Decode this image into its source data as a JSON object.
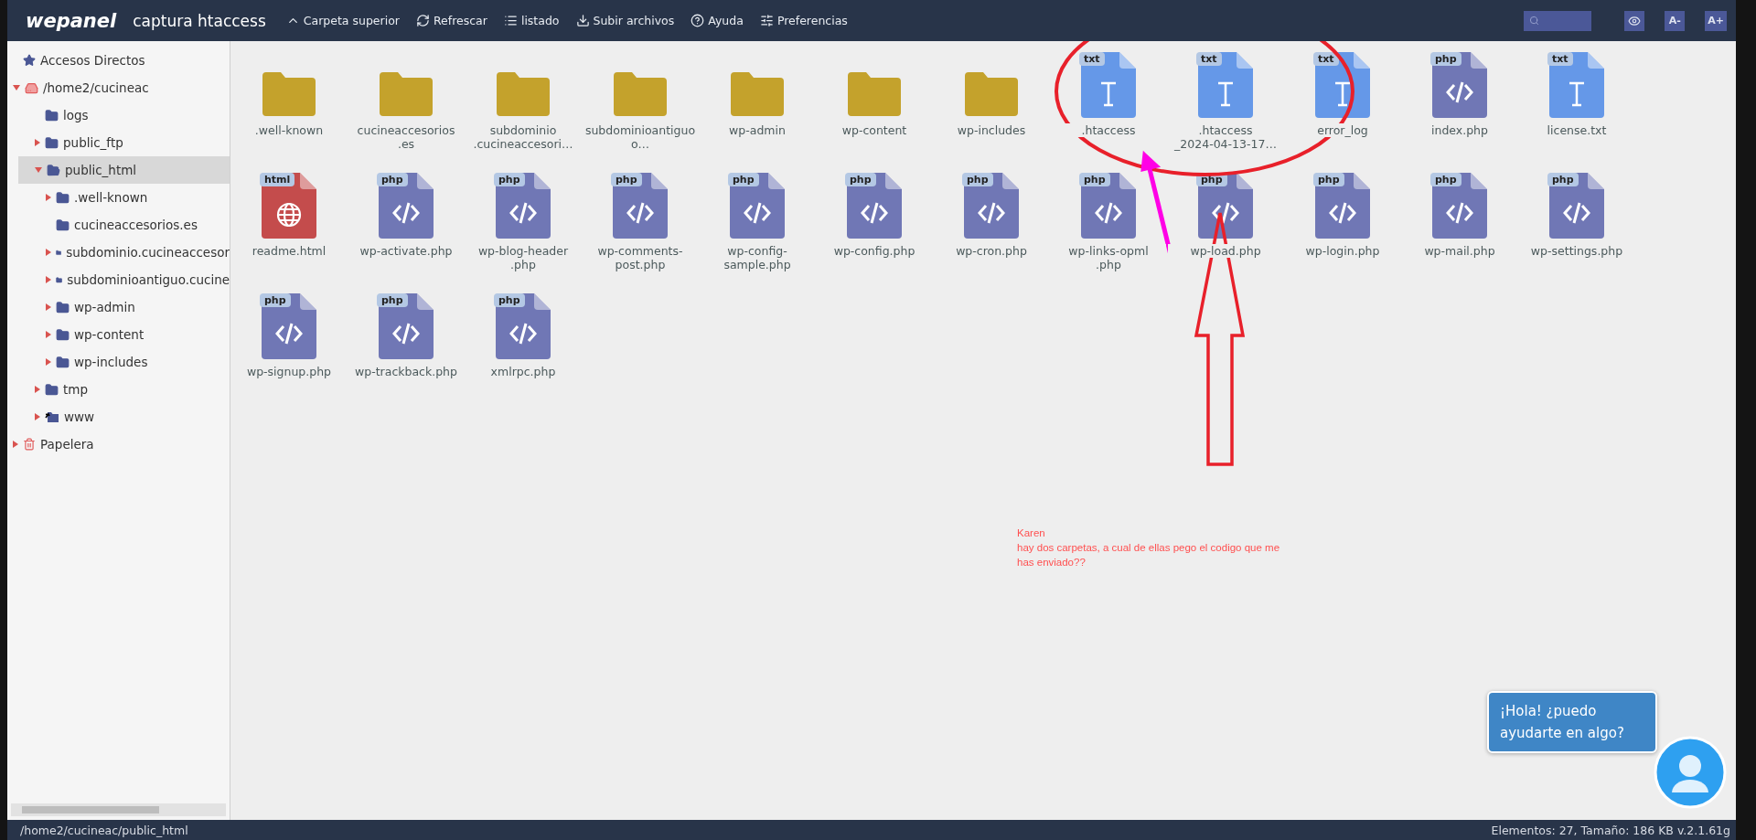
{
  "header": {
    "logo": "wepanel",
    "title": "captura htaccess",
    "toolbar": [
      {
        "kind": "up",
        "label": "Carpeta superior"
      },
      {
        "kind": "refresh",
        "label": "Refrescar"
      },
      {
        "kind": "list",
        "label": "listado"
      },
      {
        "kind": "upload",
        "label": "Subir archivos"
      },
      {
        "kind": "help",
        "label": "Ayuda"
      },
      {
        "kind": "prefs",
        "label": "Preferencias"
      }
    ],
    "font_buttons": [
      "A-",
      "A+"
    ]
  },
  "sidebar": {
    "tree": [
      {
        "label": "Accesos Directos",
        "kind": "shortcut",
        "selected": false
      },
      {
        "label": "/home2/cucineac",
        "kind": "drive",
        "expanded": true,
        "selected": false,
        "children": [
          {
            "label": "logs",
            "kind": "folder",
            "selected": false
          },
          {
            "label": "public_ftp",
            "kind": "folder",
            "expanded": false,
            "selected": false
          },
          {
            "label": "public_html",
            "kind": "folder-open",
            "expanded": true,
            "selected": true,
            "children": [
              {
                "label": ".well-known",
                "kind": "folder",
                "expanded": false,
                "selected": false
              },
              {
                "label": "cucineaccesorios.es",
                "kind": "folder",
                "selected": false
              },
              {
                "label": "subdominio.cucineaccesor",
                "kind": "folder",
                "expanded": false,
                "selected": false
              },
              {
                "label": "subdominioantiguo.cucine",
                "kind": "folder",
                "expanded": false,
                "selected": false
              },
              {
                "label": "wp-admin",
                "kind": "folder",
                "expanded": false,
                "selected": false
              },
              {
                "label": "wp-content",
                "kind": "folder",
                "expanded": false,
                "selected": false
              },
              {
                "label": "wp-includes",
                "kind": "folder",
                "expanded": false,
                "selected": false
              }
            ]
          },
          {
            "label": "tmp",
            "kind": "folder",
            "expanded": false,
            "selected": false
          },
          {
            "label": "www",
            "kind": "link-folder",
            "expanded": false,
            "selected": false
          }
        ]
      },
      {
        "label": "Papelera",
        "kind": "trash",
        "expanded": false,
        "selected": false
      }
    ]
  },
  "files": [
    {
      "kind": "folder",
      "lines": [
        ".well-known"
      ]
    },
    {
      "kind": "folder",
      "lines": [
        "cucineaccesorios",
        ".es"
      ]
    },
    {
      "kind": "folder",
      "lines": [
        "subdominio",
        ".cucineaccesori…"
      ]
    },
    {
      "kind": "folder",
      "lines": [
        "subdominioantiguo",
        "o…"
      ]
    },
    {
      "kind": "folder",
      "lines": [
        "wp-admin"
      ]
    },
    {
      "kind": "folder",
      "lines": [
        "wp-content"
      ]
    },
    {
      "kind": "folder",
      "lines": [
        "wp-includes"
      ]
    },
    {
      "kind": "txt",
      "badge": "txt",
      "lines": [
        ".htaccess"
      ]
    },
    {
      "kind": "txt",
      "badge": "txt",
      "lines": [
        ".htaccess",
        "_2024-04-13-17…"
      ]
    },
    {
      "kind": "txt",
      "badge": "txt",
      "lines": [
        "error_log"
      ]
    },
    {
      "kind": "php",
      "badge": "php",
      "lines": [
        "index.php"
      ]
    },
    {
      "kind": "txt",
      "badge": "txt",
      "lines": [
        "license.txt"
      ]
    },
    {
      "kind": "html",
      "badge": "html",
      "lines": [
        "readme.html"
      ]
    },
    {
      "kind": "php",
      "badge": "php",
      "lines": [
        "wp-activate.php"
      ]
    },
    {
      "kind": "php",
      "badge": "php",
      "lines": [
        "wp-blog-header",
        ".php"
      ]
    },
    {
      "kind": "php",
      "badge": "php",
      "lines": [
        "wp-comments-",
        "post.php"
      ]
    },
    {
      "kind": "php",
      "badge": "php",
      "lines": [
        "wp-config-",
        "sample.php"
      ]
    },
    {
      "kind": "php",
      "badge": "php",
      "lines": [
        "wp-config.php"
      ]
    },
    {
      "kind": "php",
      "badge": "php",
      "lines": [
        "wp-cron.php"
      ]
    },
    {
      "kind": "php",
      "badge": "php",
      "lines": [
        "wp-links-opml",
        ".php"
      ]
    },
    {
      "kind": "php",
      "badge": "php",
      "lines": [
        "wp-load.php"
      ]
    },
    {
      "kind": "php",
      "badge": "php",
      "lines": [
        "wp-login.php"
      ]
    },
    {
      "kind": "php",
      "badge": "php",
      "lines": [
        "wp-mail.php"
      ]
    },
    {
      "kind": "php",
      "badge": "php",
      "lines": [
        "wp-settings.php"
      ]
    },
    {
      "kind": "php",
      "badge": "php",
      "lines": [
        "wp-signup.php"
      ]
    },
    {
      "kind": "php",
      "badge": "php",
      "lines": [
        "wp-trackback.php"
      ]
    },
    {
      "kind": "php",
      "badge": "php",
      "lines": [
        "xmlrpc.php"
      ]
    }
  ],
  "annotation": {
    "author": "Karen",
    "lines": [
      "hay dos carpetas, a cual de ellas pego el codigo que me",
      "has enviado??"
    ]
  },
  "chat": {
    "message": "¡Hola! ¿puedo ayudarte en algo?"
  },
  "status_bar": {
    "path": "/home2/cucineac/public_html",
    "info": "Elementos: 27, Tamaño: 186 KB v.2.1.61g"
  }
}
